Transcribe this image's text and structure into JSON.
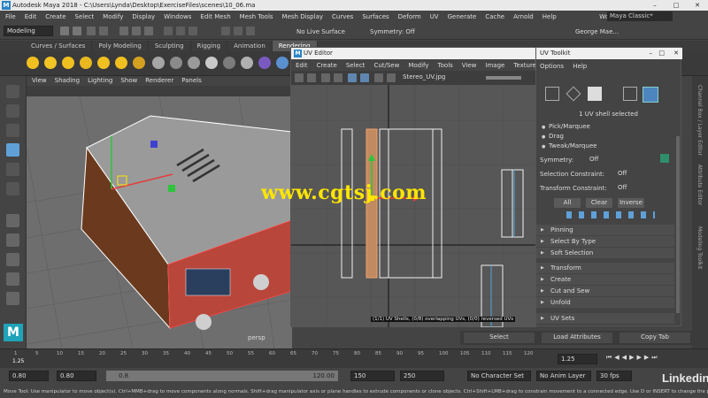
{
  "window": {
    "title": "Autodesk Maya 2018 - C:\\Users\\Lynda\\Desktop\\ExerciseFiles\\scenes\\10_06.ma"
  },
  "menubar": {
    "items": [
      "File",
      "Edit",
      "Create",
      "Select",
      "Modify",
      "Display",
      "Windows",
      "Edit Mesh",
      "Mesh Tools",
      "Mesh Display",
      "Curves",
      "Surfaces",
      "Deform",
      "UV",
      "Generate",
      "Cache",
      "Arnold",
      "Help"
    ],
    "workspace_label": "Workspace :",
    "workspace_value": "Maya Classic*"
  },
  "statusline": {
    "mode": "Modeling",
    "live_surface": "No Live Surface",
    "symmetry": "Symmetry: Off",
    "user": "George Mae..."
  },
  "shelf": {
    "tabs": [
      "Curves / Surfaces",
      "Poly Modeling",
      "Sculpting",
      "Rigging",
      "Animation",
      "Rendering"
    ],
    "active_tab": "Rendering"
  },
  "viewport": {
    "menu": [
      "View",
      "Shading",
      "Lighting",
      "Show",
      "Renderer",
      "Panels"
    ],
    "camera": "persp"
  },
  "uv_editor": {
    "title": "UV Editor",
    "menu": [
      "Edit",
      "Create",
      "Select",
      "Cut/Sew",
      "Modify",
      "Tools",
      "View",
      "Image",
      "Textures"
    ],
    "texture": "Stereo_UV.jpg",
    "overlay_text": "(1/1) UV Shells, (0/8) overlapping UVs, (0/0) reversed UVs"
  },
  "uv_toolkit": {
    "title": "UV Toolkit",
    "menu": [
      "Options",
      "Help"
    ],
    "selected_info": "1 UV shell selected",
    "pick_options": [
      "Pick/Marquee",
      "Drag",
      "Tweak/Marquee"
    ],
    "symmetry_label": "Symmetry:",
    "symmetry_value": "Off",
    "selection_constraint_label": "Selection Constraint:",
    "selection_constraint_value": "Off",
    "transform_constraint_label": "Transform Constraint:",
    "transform_constraint_value": "Off",
    "buttons": [
      "All",
      "Clear",
      "Inverse"
    ],
    "sections_top": [
      "Pinning",
      "Select By Type",
      "Soft Selection"
    ],
    "sections": [
      "Transform",
      "Create",
      "Cut and Sew",
      "Unfold"
    ],
    "uv_sets": "UV Sets"
  },
  "right_strip": {
    "tabs": [
      "Channel Box / Layer Editor",
      "Attribute Editor",
      "Modeling Toolkit"
    ]
  },
  "bottom_buttons": [
    "Select",
    "Load Attributes",
    "Copy Tab"
  ],
  "timeline": {
    "ticks": [
      "1",
      "5",
      "10",
      "15",
      "20",
      "25",
      "30",
      "35",
      "40",
      "45",
      "50",
      "55",
      "60",
      "65",
      "70",
      "75",
      "80",
      "85",
      "90",
      "95",
      "100",
      "105",
      "110",
      "115",
      "120"
    ],
    "current_frame": "1.25",
    "current_frame_right": "1.25"
  },
  "range": {
    "start": "0.80",
    "start2": "0.80",
    "slider_start": "0.8",
    "slider_end": "120.00",
    "end": "150",
    "end2": "250",
    "character_set": "No Character Set",
    "anim_layer": "No Anim Layer",
    "fps": "30 fps"
  },
  "helpline": "Move Tool: Use manipulator to move object(s). Ctrl+MMB+drag to move components along normals. Shift+drag manipulator axis or plane handles to extrude components or clone objects. Ctrl+Shift+LMB+drag to constrain movement to a connected edge. Use D or INSERT to change the pivot position",
  "watermark": "www.cgtsj.com",
  "branding": "Linkedin",
  "colors": {
    "accent": "#2a84c6",
    "selection": "#e2a06a",
    "watermark": "#ffe600"
  }
}
